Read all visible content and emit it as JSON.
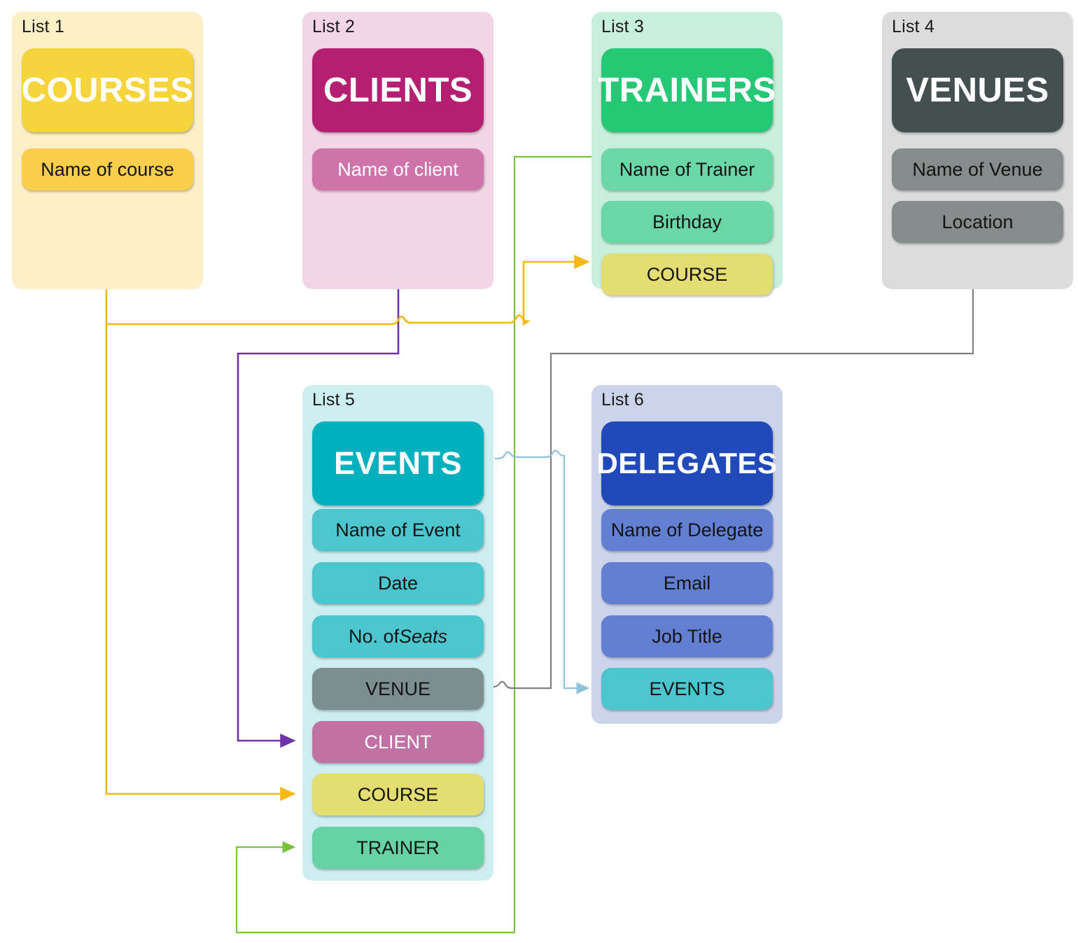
{
  "diagram": {
    "title": "Course management lists relationship diagram",
    "background": "#ffffff"
  },
  "lists": [
    {
      "label": "List 1",
      "header": "COURSES",
      "card_bg": "#fdf0c9",
      "header_bg": "#f6d43c",
      "header_text_color": "#ffffff",
      "fields": [
        {
          "label": "Name of course",
          "bg": "#fbcf4b",
          "text_color": "#141414"
        }
      ]
    },
    {
      "label": "List 2",
      "header": "CLIENTS",
      "card_bg": "#f2d5e6",
      "header_bg": "#b51f71",
      "header_text_color": "#ffffff",
      "fields": [
        {
          "label": "Name of client",
          "bg": "#cf74aa",
          "text_color": "#ffffff"
        }
      ]
    },
    {
      "label": "List 3",
      "header": "TRAINERS",
      "card_bg": "#c7efdb",
      "header_bg": "#25c975",
      "header_text_color": "#ffffff",
      "fields": [
        {
          "label": "Name of Trainer",
          "bg": "#6bd7a7",
          "text_color": "#141414"
        },
        {
          "label": "Birthday",
          "bg": "#6bd7a7",
          "text_color": "#141414"
        },
        {
          "label": "COURSE",
          "bg": "#e4de72",
          "text_color": "#141414"
        }
      ]
    },
    {
      "label": "List 4",
      "header": "VENUES",
      "card_bg": "#dcdcdc",
      "header_bg": "#444f4f",
      "header_text_color": "#ffffff",
      "fields": [
        {
          "label": "Name of Venue",
          "bg": "#868c8c",
          "text_color": "#141414"
        },
        {
          "label": "Location",
          "bg": "#868c8c",
          "text_color": "#141414"
        }
      ]
    },
    {
      "label": "List 5",
      "header": "EVENTS",
      "card_bg": "#cdeef0",
      "header_bg": "#00b0bd",
      "header_text_color": "#ffffff",
      "fields": [
        {
          "label": "Name of Event",
          "bg": "#4dc5cf",
          "text_color": "#141414"
        },
        {
          "label": "Date",
          "bg": "#4dc5cf",
          "text_color": "#141414"
        },
        {
          "label": "No. of Seats",
          "label_plain": "No. of ",
          "label_italic": "Seats",
          "bg": "#4dc5cf",
          "text_color": "#141414"
        },
        {
          "label": "VENUE",
          "bg": "#7d8e90",
          "text_color": "#141414"
        },
        {
          "label": "CLIENT",
          "bg": "#c172a5",
          "text_color": "#ffffff"
        },
        {
          "label": "COURSE",
          "bg": "#e4de72",
          "text_color": "#141414"
        },
        {
          "label": "TRAINER",
          "bg": "#66d3a5",
          "text_color": "#141414"
        }
      ]
    },
    {
      "label": "List 6",
      "header": "DELEGATES",
      "card_bg": "#ccd4ec",
      "header_bg": "#2049b9",
      "header_text_color": "#ffffff",
      "fields": [
        {
          "label": "Name of Delegate",
          "bg": "#627fd2",
          "text_color": "#141414"
        },
        {
          "label": "Email",
          "bg": "#627fd2",
          "text_color": "#141414"
        },
        {
          "label": "Job Title",
          "bg": "#627fd2",
          "text_color": "#141414"
        },
        {
          "label": "EVENTS",
          "bg": "#4dc5cf",
          "text_color": "#141414"
        }
      ]
    }
  ],
  "connectors": [
    {
      "name": "courses-to-trainers-course",
      "color": "#f5b712",
      "from": "COURSES",
      "to": "TRAINERS.COURSE"
    },
    {
      "name": "courses-to-events-course",
      "color": "#f5b712",
      "from": "COURSES",
      "to": "EVENTS.COURSE"
    },
    {
      "name": "clients-to-events-client",
      "color": "#7232a8",
      "from": "CLIENTS",
      "to": "EVENTS.CLIENT"
    },
    {
      "name": "trainers-to-events-trainer",
      "color": "#7cc040",
      "from": "TRAINERS.Name of Trainer",
      "to": "EVENTS.TRAINER"
    },
    {
      "name": "venues-to-events-venue",
      "color": "#808080",
      "from": "VENUES",
      "to": "EVENTS.VENUE"
    },
    {
      "name": "events-to-delegates-events",
      "color": "#8fc3d9",
      "from": "EVENTS",
      "to": "DELEGATES.EVENTS"
    }
  ]
}
